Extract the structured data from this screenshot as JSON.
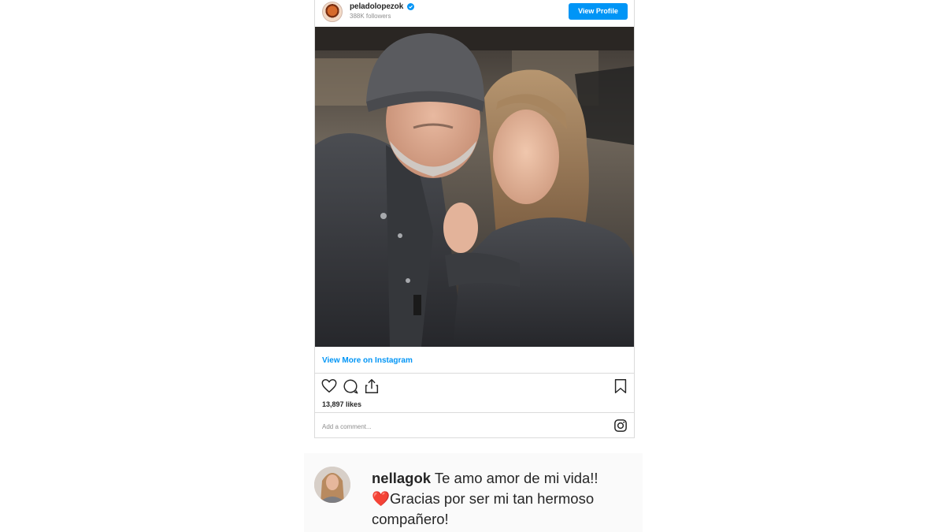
{
  "embed": {
    "username": "peladolopezok",
    "followers": "388K followers",
    "view_profile_label": "View Profile",
    "view_more_label": "View More on Instagram",
    "likes": "13,897 likes",
    "add_comment_placeholder": "Add a comment..."
  },
  "icons": {
    "verified": "verified-badge-icon",
    "like": "heart-outline-icon",
    "comment": "comment-bubble-icon",
    "share": "share-icon",
    "save": "bookmark-icon",
    "instagram": "instagram-glyph-icon"
  },
  "comment": {
    "username": "nellagok",
    "text_line": "Te amo amor de mi vida!!",
    "heart": "❤️",
    "text_rest": "Gracias por ser mi tan hermoso compañero!"
  },
  "colors": {
    "accent": "#0095f6",
    "text": "#262626",
    "muted": "#8e8e8e",
    "border": "#dbdbdb",
    "heart": "#e0245e"
  }
}
